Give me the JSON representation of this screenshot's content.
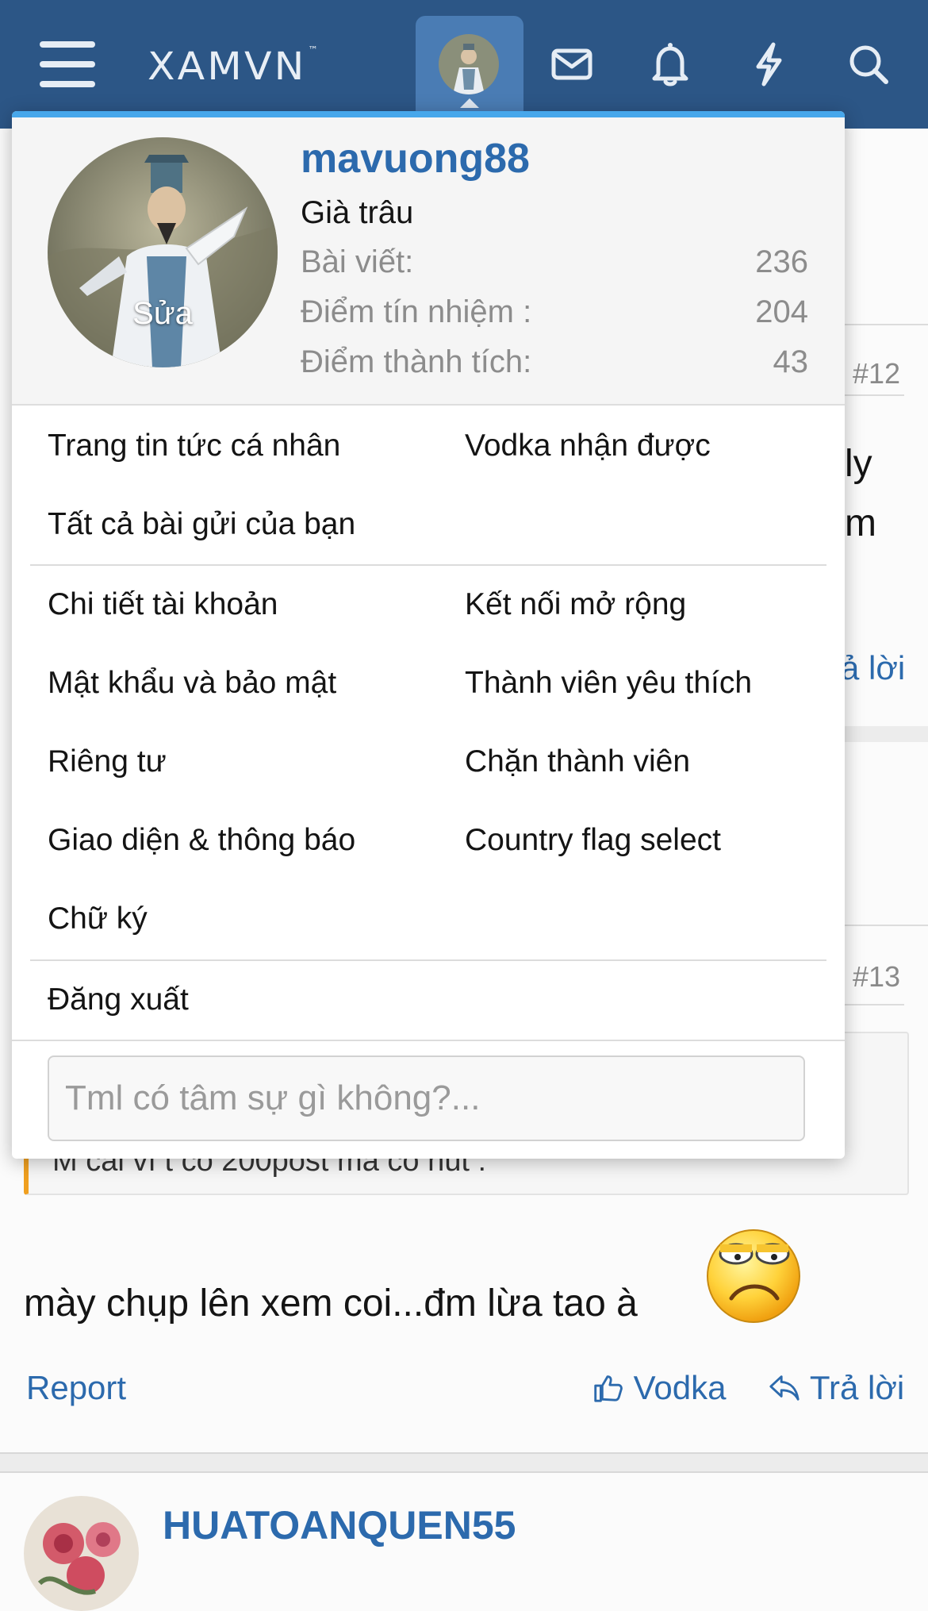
{
  "header": {
    "logo_text": "XAMVN",
    "logo_tm": "™",
    "icons": [
      "menu-icon",
      "avatar",
      "mail-icon",
      "bell-icon",
      "bolt-icon",
      "search-icon"
    ],
    "bar_color": "#2c5686",
    "active_tab_color": "#4a7cb4"
  },
  "account_menu": {
    "avatar_edit_label": "Sửa",
    "username": "mavuong88",
    "user_title": "Già trâu",
    "stats": [
      {
        "label": "Bài viết:",
        "value": "236"
      },
      {
        "label": "Điểm tín nhiệm :",
        "value": "204"
      },
      {
        "label": "Điểm thành tích:",
        "value": "43"
      }
    ],
    "group1_left": [
      "Trang tin tức cá nhân",
      "Tất cả bài gửi của bạn"
    ],
    "group1_right": [
      "Vodka nhận được"
    ],
    "group2_left": [
      "Chi tiết tài khoản",
      "Mật khẩu và bảo mật",
      "Riêng tư",
      "Giao diện & thông báo",
      "Chữ ký"
    ],
    "group2_right": [
      "Kết nối mở rộng",
      "Thành viên yêu thích",
      "Chặn thành viên",
      "Country flag select"
    ],
    "logout_label": "Đăng xuất",
    "status_placeholder": "Tml có tâm sự gì không?...",
    "accent_color": "#47a7eb",
    "link_color": "#2c6aad"
  },
  "background": {
    "post12_number": "#12",
    "fragment_1": "ly",
    "fragment_2": "m",
    "fragment_3": "ả lời",
    "post13_number": "#13",
    "quote_fragment": "M cái vì t có 200post mà có hút :",
    "post_text": "mày chụp lên xem coi...đm lừa tao à",
    "report_label": "Report",
    "vodka_label": "Vodka",
    "reply_label": "Trả lời",
    "next_username": "HUATOANQUEN55"
  }
}
